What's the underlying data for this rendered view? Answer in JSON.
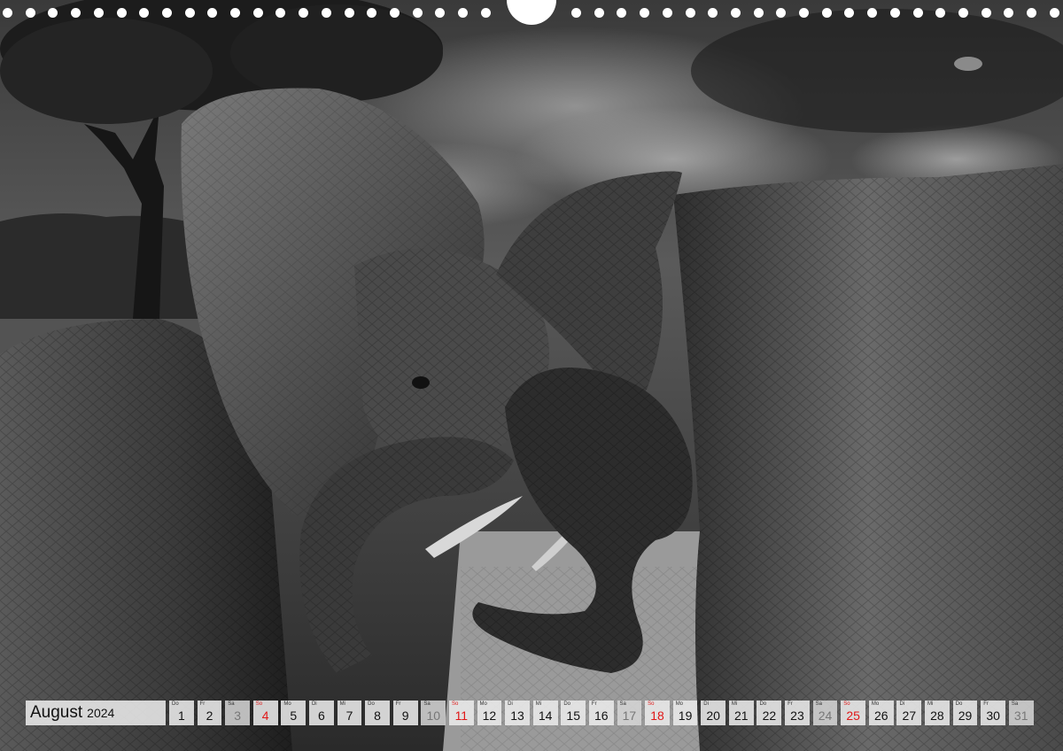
{
  "calendar": {
    "month": "August",
    "year": "2024",
    "days": [
      {
        "dn": "Do",
        "num": "1",
        "kind": "weekday"
      },
      {
        "dn": "Fr",
        "num": "2",
        "kind": "weekday"
      },
      {
        "dn": "Sa",
        "num": "3",
        "kind": "sat"
      },
      {
        "dn": "So",
        "num": "4",
        "kind": "sun"
      },
      {
        "dn": "Mo",
        "num": "5",
        "kind": "weekday"
      },
      {
        "dn": "Di",
        "num": "6",
        "kind": "weekday"
      },
      {
        "dn": "Mi",
        "num": "7",
        "kind": "weekday"
      },
      {
        "dn": "Do",
        "num": "8",
        "kind": "weekday"
      },
      {
        "dn": "Fr",
        "num": "9",
        "kind": "weekday"
      },
      {
        "dn": "Sa",
        "num": "10",
        "kind": "sat"
      },
      {
        "dn": "So",
        "num": "11",
        "kind": "sun"
      },
      {
        "dn": "Mo",
        "num": "12",
        "kind": "weekday"
      },
      {
        "dn": "Di",
        "num": "13",
        "kind": "weekday"
      },
      {
        "dn": "Mi",
        "num": "14",
        "kind": "weekday"
      },
      {
        "dn": "Do",
        "num": "15",
        "kind": "weekday"
      },
      {
        "dn": "Fr",
        "num": "16",
        "kind": "weekday"
      },
      {
        "dn": "Sa",
        "num": "17",
        "kind": "sat"
      },
      {
        "dn": "So",
        "num": "18",
        "kind": "sun"
      },
      {
        "dn": "Mo",
        "num": "19",
        "kind": "weekday"
      },
      {
        "dn": "Di",
        "num": "20",
        "kind": "weekday"
      },
      {
        "dn": "Mi",
        "num": "21",
        "kind": "weekday"
      },
      {
        "dn": "Do",
        "num": "22",
        "kind": "weekday"
      },
      {
        "dn": "Fr",
        "num": "23",
        "kind": "weekday"
      },
      {
        "dn": "Sa",
        "num": "24",
        "kind": "sat"
      },
      {
        "dn": "So",
        "num": "25",
        "kind": "sun"
      },
      {
        "dn": "Mo",
        "num": "26",
        "kind": "weekday"
      },
      {
        "dn": "Di",
        "num": "27",
        "kind": "weekday"
      },
      {
        "dn": "Mi",
        "num": "28",
        "kind": "weekday"
      },
      {
        "dn": "Do",
        "num": "29",
        "kind": "weekday"
      },
      {
        "dn": "Fr",
        "num": "30",
        "kind": "weekday"
      },
      {
        "dn": "Sa",
        "num": "31",
        "kind": "sat"
      }
    ]
  },
  "colors": {
    "sunday_red": "#e01818",
    "cell_background": "#ebebeb",
    "binding_holes": "#ffffff"
  },
  "photo": {
    "subject": "two-elephants-black-and-white"
  }
}
